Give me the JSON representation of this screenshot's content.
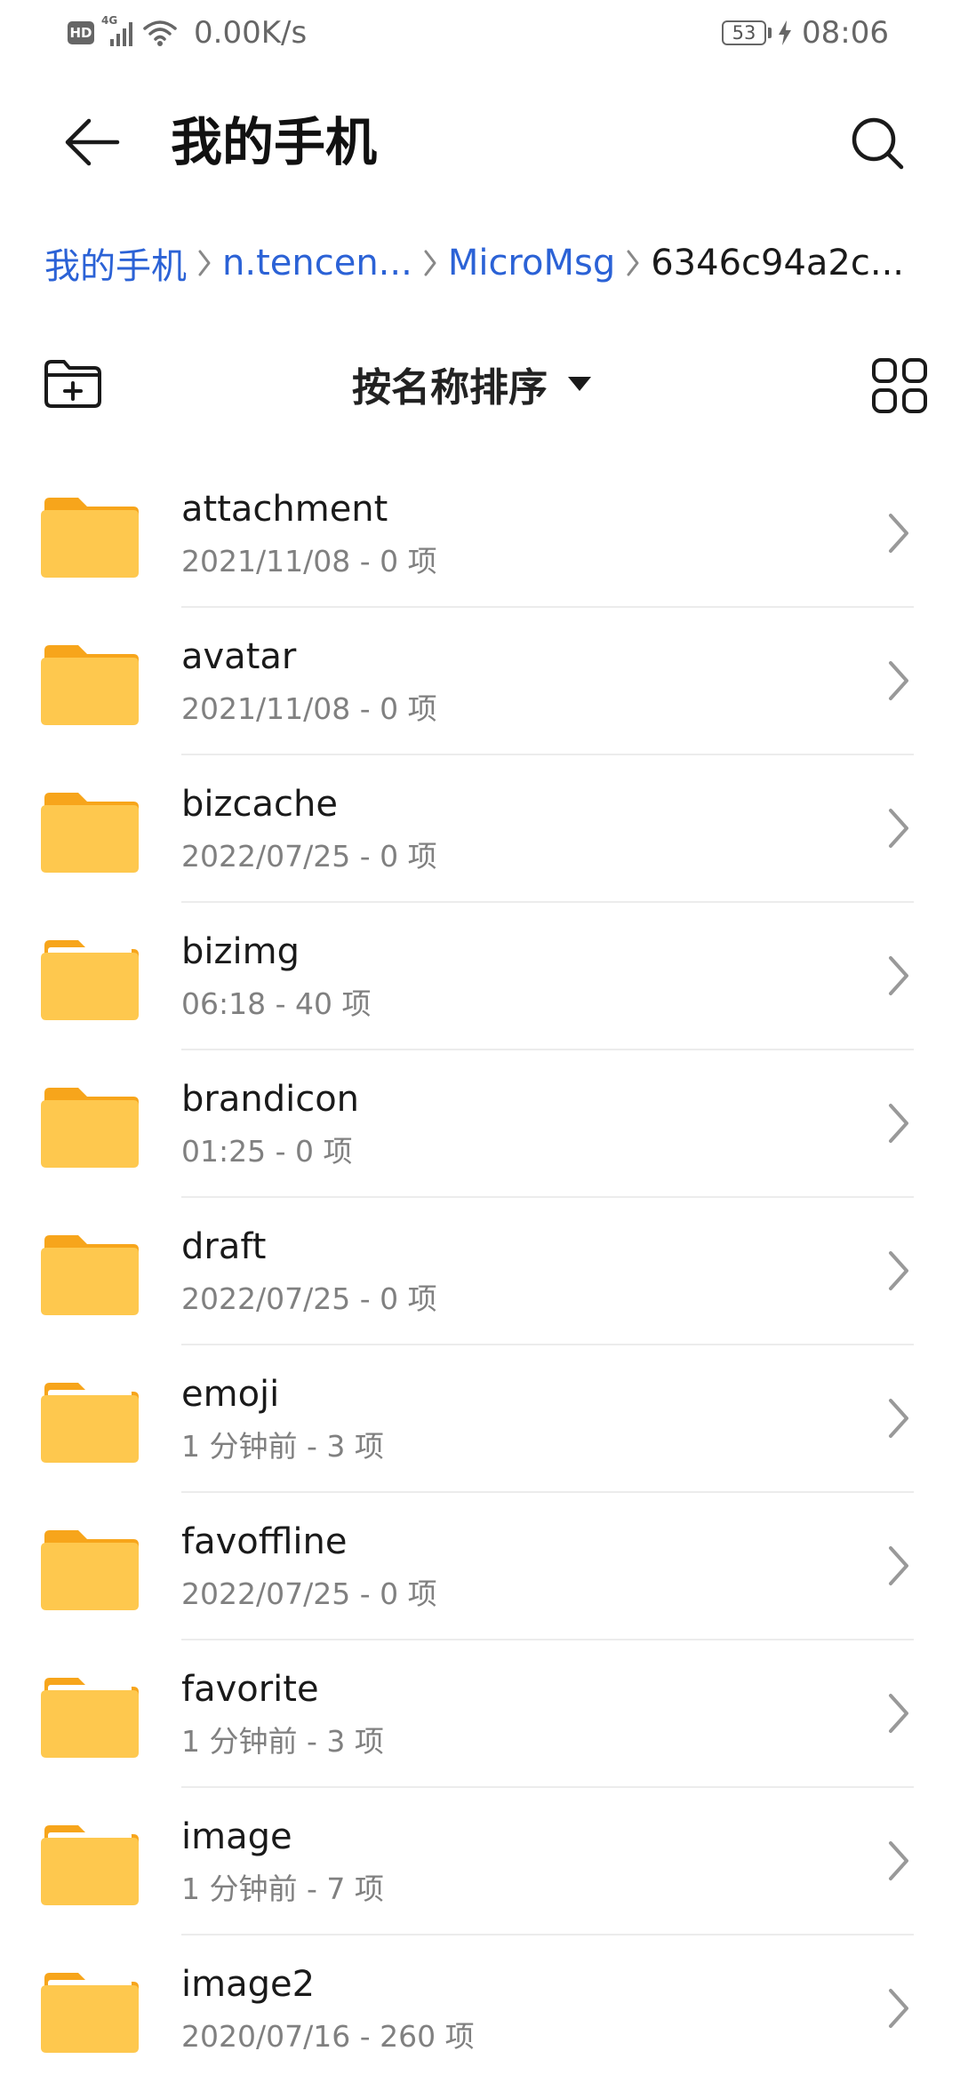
{
  "status_bar": {
    "hd": "HD",
    "network": "4G",
    "speed": "0.00K/s",
    "battery": "53",
    "time": "08:06"
  },
  "header": {
    "title": "我的手机",
    "back_icon": "arrow-left-icon",
    "search_icon": "search-icon"
  },
  "breadcrumb": {
    "items": [
      "我的手机",
      "n.tencen...",
      "MicroMsg"
    ],
    "current": "6346c94a2c..."
  },
  "toolbar": {
    "new_folder_icon": "new-folder-icon",
    "sort_label": "按名称排序",
    "view_icon": "grid-view-icon"
  },
  "colors": {
    "accent": "#2b62d6",
    "folder": "#fec84e",
    "folder_tab": "#f7a51b"
  },
  "files": [
    {
      "name": "attachment",
      "meta": "2021/11/08 - 0 项"
    },
    {
      "name": "avatar",
      "meta": "2021/11/08 - 0 项"
    },
    {
      "name": "bizcache",
      "meta": "2022/07/25 - 0 项"
    },
    {
      "name": "bizimg",
      "meta": "06:18 - 40 项"
    },
    {
      "name": "brandicon",
      "meta": "01:25 - 0 项"
    },
    {
      "name": "draft",
      "meta": "2022/07/25 - 0 项"
    },
    {
      "name": "emoji",
      "meta": "1 分钟前 - 3 项"
    },
    {
      "name": "favoffline",
      "meta": "2022/07/25 - 0 项"
    },
    {
      "name": "favorite",
      "meta": "1 分钟前 - 3 项"
    },
    {
      "name": "image",
      "meta": "1 分钟前 - 7 项"
    },
    {
      "name": "image2",
      "meta": "2020/07/16 - 260 项"
    }
  ]
}
